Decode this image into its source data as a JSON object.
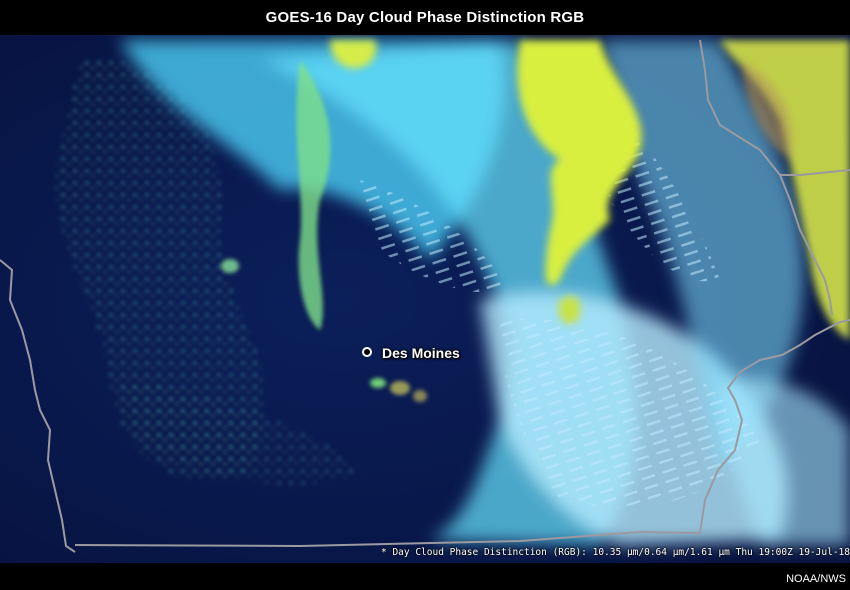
{
  "title": "GOES-16 Day Cloud Phase Distinction RGB",
  "city": {
    "name": "Des Moines"
  },
  "caption": "* Day Cloud Phase Distinction (RGB): 10.35 µm/0.64 µm/1.61 µm Thu 19:00Z 19-Jul-18",
  "credit": "NOAA/NWS",
  "colors": {
    "background": "#0a1a4a",
    "water_cloud": "#5fe0ff",
    "ice_cloud": "#d8ef40",
    "border": "#9a9aa0"
  }
}
